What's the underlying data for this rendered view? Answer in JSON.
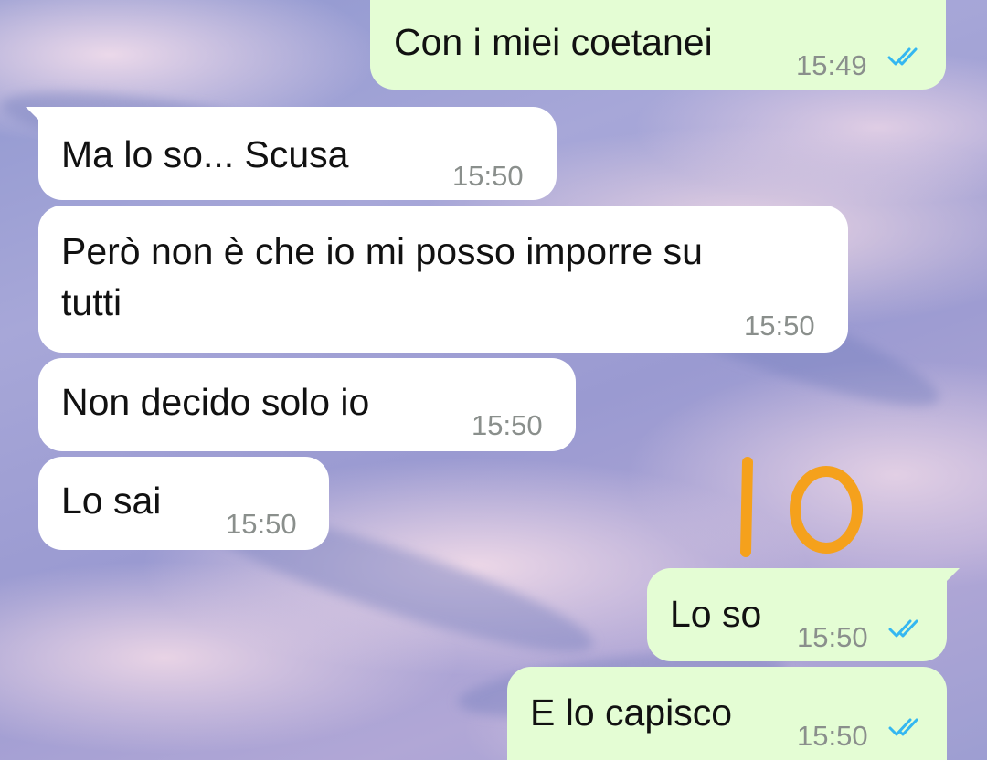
{
  "colors": {
    "incoming_bubble": "#ffffff",
    "outgoing_bubble": "#e4fdd4",
    "read_ticks": "#34b7f1",
    "timestamp": "#8a8f8c",
    "annotation": "#f5a11c"
  },
  "messages": [
    {
      "direction": "outgoing",
      "text": "Con i miei coetanei",
      "time": "15:49",
      "status": "read-double-check-icon"
    },
    {
      "direction": "incoming",
      "text": "Ma lo so... Scusa",
      "time": "15:50"
    },
    {
      "direction": "incoming",
      "text_line1": "Però non è che io mi posso imporre su",
      "text_line2": "tutti",
      "time": "15:50"
    },
    {
      "direction": "incoming",
      "text": "Non decido solo io",
      "time": "15:50"
    },
    {
      "direction": "incoming",
      "text": "Lo sai",
      "time": "15:50"
    },
    {
      "direction": "outgoing",
      "text": "Lo so",
      "time": "15:50",
      "status": "read-double-check-icon"
    },
    {
      "direction": "outgoing",
      "text": "E lo capisco",
      "time": "15:50",
      "status": "read-double-check-icon"
    }
  ],
  "annotation": {
    "text": "IO"
  }
}
